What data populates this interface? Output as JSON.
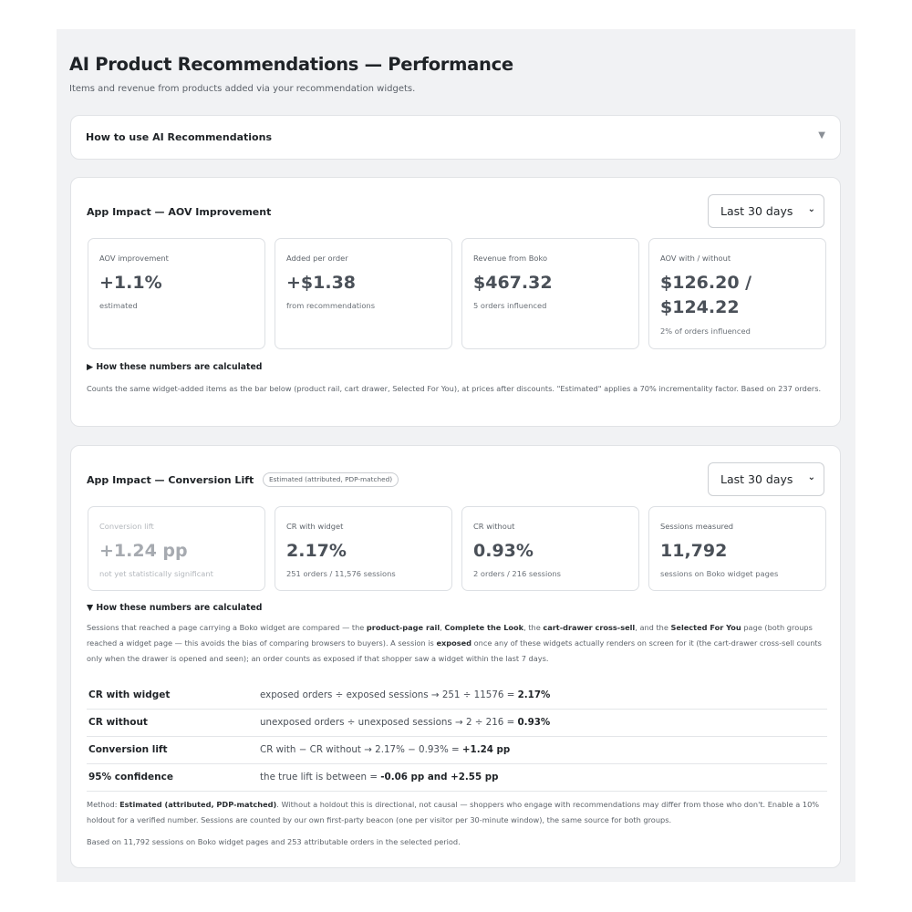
{
  "page": {
    "title": "AI Product Recommendations — Performance",
    "subtitle": "Items and revenue from products added via your recommendation widgets."
  },
  "howto": {
    "label": "How to use AI Recommendations",
    "chevron_icon": "triangle-down-icon"
  },
  "aov": {
    "title": "App Impact — AOV Improvement",
    "period": "Last 30 days",
    "metrics": [
      {
        "label": "AOV improvement",
        "value": "+1.1%",
        "sub": "estimated"
      },
      {
        "label": "Added per order",
        "value": "+$1.38",
        "sub": "from recommendations"
      },
      {
        "label": "Revenue from Boko",
        "value": "$467.32",
        "sub": "5 orders influenced"
      },
      {
        "label": "AOV with / without",
        "value_line1": "$126.20 /",
        "value_line2": "$124.22",
        "sub": "2% of orders influenced"
      }
    ],
    "details_toggle": "▶ How these numbers are calculated",
    "note": "Counts the same widget-added items as the bar below (product rail, cart drawer, Selected For You), at prices after discounts. \"Estimated\" applies a 70% incrementality factor. Based on 237 orders."
  },
  "conv": {
    "title": "App Impact — Conversion Lift",
    "badge": "Estimated (attributed, PDP-matched)",
    "period": "Last 30 days",
    "metrics": [
      {
        "label": "Conversion lift",
        "value": "+1.24 pp",
        "sub": "not yet statistically significant"
      },
      {
        "label": "CR with widget",
        "value": "2.17%",
        "sub": "251 orders / 11,576 sessions"
      },
      {
        "label": "CR without",
        "value": "0.93%",
        "sub": "2 orders / 216 sessions"
      },
      {
        "label": "Sessions measured",
        "value": "11,792",
        "sub": "sessions on Boko widget pages"
      }
    ],
    "details_toggle": "▼ How these numbers are calculated",
    "explain": {
      "t1": "Sessions that reached a page carrying a Boko widget are compared — the ",
      "b1": "product-page rail",
      "t2": ", ",
      "b2": "Complete the Look",
      "t3": ", the ",
      "b3": "cart-drawer cross-sell",
      "t4": ", and the ",
      "b4": "Selected For You",
      "t5": " page (both groups reached a widget page — this avoids the bias of comparing browsers to buyers). A session is ",
      "b5": "exposed",
      "t6": " once any of these widgets actually renders on screen for it (the cart-drawer cross-sell counts only when the drawer is opened and seen); an order counts as exposed if that shopper saw a widget within the last 7 days."
    },
    "rows": [
      {
        "key": "CR with widget",
        "formula": "exposed orders ÷ exposed sessions → 251 ÷ 11576 = ",
        "result": "2.17%"
      },
      {
        "key": "CR without",
        "formula": "unexposed orders ÷ unexposed sessions → 2 ÷ 216 = ",
        "result": "0.93%"
      },
      {
        "key": "Conversion lift",
        "formula": "CR with − CR without → 2.17% − 0.93% = ",
        "result": "+1.24 pp"
      },
      {
        "key": "95% confidence",
        "formula": "the true lift is between = ",
        "result": "-0.06 pp and +2.55 pp"
      }
    ],
    "method": {
      "t1": "Method: ",
      "b1": "Estimated (attributed, PDP-matched)",
      "t2": ". Without a holdout this is directional, not causal — shoppers who engage with recommendations may differ from those who don't. Enable a 10% holdout for a verified number. Sessions are counted by our own first-party beacon (one per visitor per 30-minute window), the same source for both groups."
    },
    "based_on": "Based on 11,792 sessions on Boko widget pages and 253 attributable orders in the selected period."
  }
}
